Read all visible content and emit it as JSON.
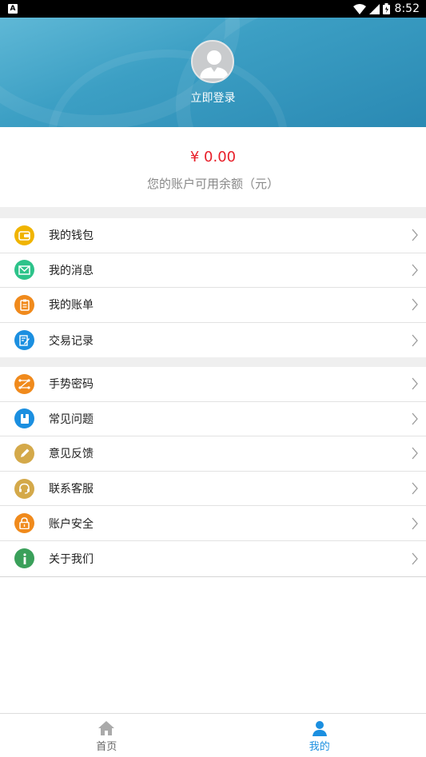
{
  "status_bar": {
    "time": "8:52",
    "notification_badge": "A"
  },
  "header": {
    "login_label": "立即登录"
  },
  "balance": {
    "amount": "¥ 0.00",
    "label": "您的账户可用余额（元）"
  },
  "menu_groups": [
    {
      "items": [
        {
          "label": "我的钱包",
          "icon": "wallet-icon",
          "color": "#f0b400"
        },
        {
          "label": "我的消息",
          "icon": "mail-icon",
          "color": "#2dc38a"
        },
        {
          "label": "我的账单",
          "icon": "clipboard-icon",
          "color": "#f08a1c"
        },
        {
          "label": "交易记录",
          "icon": "edit-document-icon",
          "color": "#1b8fe0"
        }
      ]
    },
    {
      "items": [
        {
          "label": "手势密码",
          "icon": "gesture-icon",
          "color": "#f08a1c"
        },
        {
          "label": "常见问题",
          "icon": "book-icon",
          "color": "#1b8fe0"
        },
        {
          "label": "意见反馈",
          "icon": "pencil-icon",
          "color": "#d4a94a"
        },
        {
          "label": "联系客服",
          "icon": "headset-icon",
          "color": "#d4a94a"
        },
        {
          "label": "账户安全",
          "icon": "lock-icon",
          "color": "#f08a1c"
        },
        {
          "label": "关于我们",
          "icon": "info-icon",
          "color": "#3aa05a"
        }
      ]
    }
  ],
  "bottom_nav": {
    "tabs": [
      {
        "label": "首页",
        "icon": "home-icon",
        "active": false
      },
      {
        "label": "我的",
        "icon": "user-icon",
        "active": true
      }
    ],
    "active_color": "#1b8fe0",
    "inactive_color": "#666666"
  }
}
